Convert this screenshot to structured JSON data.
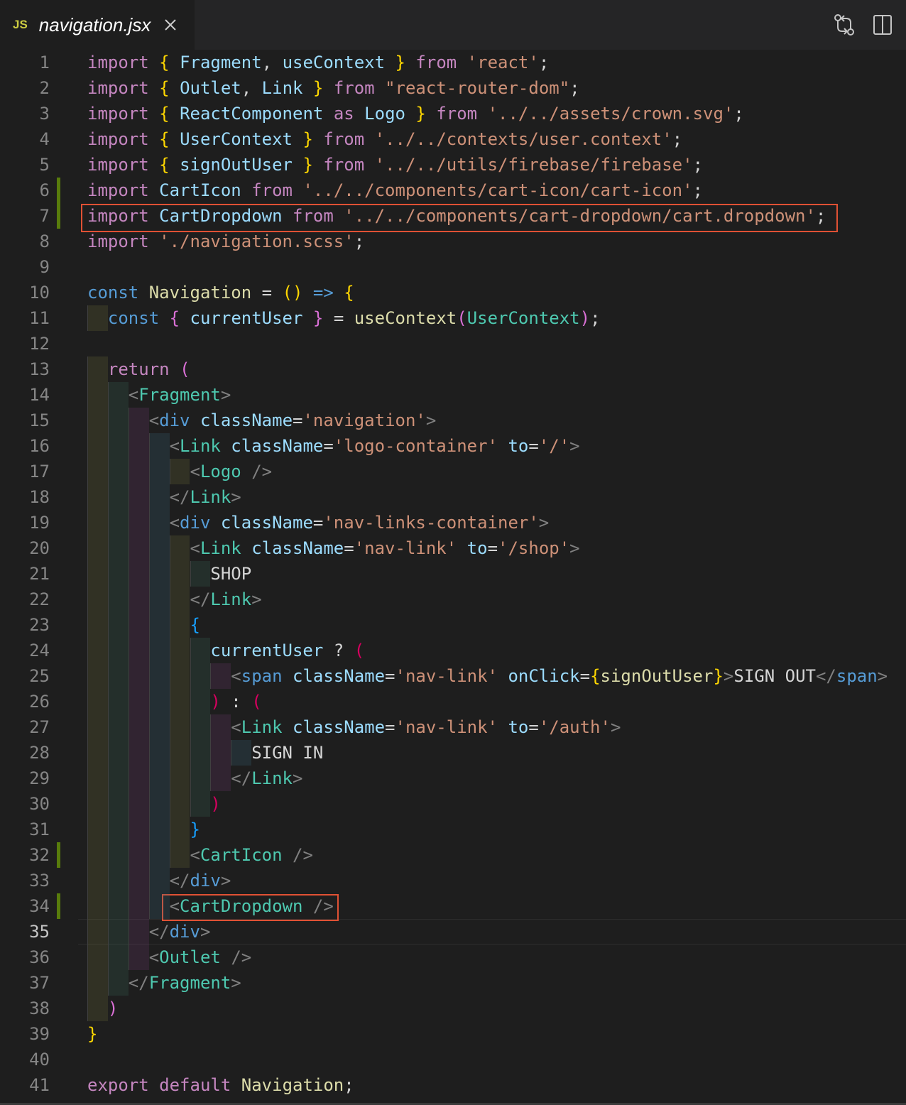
{
  "tab": {
    "language_badge": "JS",
    "filename": "navigation.jsx",
    "close_icon": "close-icon",
    "actions": [
      "compare-changes-icon",
      "split-editor-icon"
    ]
  },
  "colors": {
    "keyword": "#c586c0",
    "storage": "#569cd6",
    "variable": "#9cdcfe",
    "string": "#ce9178",
    "function": "#dcdcaa",
    "component": "#4ec9b0",
    "highlight_box": "#e05134",
    "git_added": "#587c0c"
  },
  "editor": {
    "active_line": 35,
    "lines": [
      {
        "n": 1,
        "tokens": [
          [
            "kw",
            "import"
          ],
          [
            "tx",
            " "
          ],
          [
            "b1",
            "{"
          ],
          [
            "tx",
            " "
          ],
          [
            "vr",
            "Fragment"
          ],
          [
            "tx",
            ", "
          ],
          [
            "vr",
            "useContext"
          ],
          [
            "tx",
            " "
          ],
          [
            "b1",
            "}"
          ],
          [
            "tx",
            " "
          ],
          [
            "kw",
            "from"
          ],
          [
            "tx",
            " "
          ],
          [
            "str",
            "'react'"
          ],
          [
            "tx",
            ";"
          ]
        ]
      },
      {
        "n": 2,
        "tokens": [
          [
            "kw",
            "import"
          ],
          [
            "tx",
            " "
          ],
          [
            "b1",
            "{"
          ],
          [
            "tx",
            " "
          ],
          [
            "vr",
            "Outlet"
          ],
          [
            "tx",
            ", "
          ],
          [
            "vr",
            "Link"
          ],
          [
            "tx",
            " "
          ],
          [
            "b1",
            "}"
          ],
          [
            "tx",
            " "
          ],
          [
            "kw",
            "from"
          ],
          [
            "tx",
            " "
          ],
          [
            "str",
            "\"react-router-dom\""
          ],
          [
            "tx",
            ";"
          ]
        ]
      },
      {
        "n": 3,
        "tokens": [
          [
            "kw",
            "import"
          ],
          [
            "tx",
            " "
          ],
          [
            "b1",
            "{"
          ],
          [
            "tx",
            " "
          ],
          [
            "vr",
            "ReactComponent"
          ],
          [
            "tx",
            " "
          ],
          [
            "kw",
            "as"
          ],
          [
            "tx",
            " "
          ],
          [
            "vr",
            "Logo"
          ],
          [
            "tx",
            " "
          ],
          [
            "b1",
            "}"
          ],
          [
            "tx",
            " "
          ],
          [
            "kw",
            "from"
          ],
          [
            "tx",
            " "
          ],
          [
            "str",
            "'../../assets/crown.svg'"
          ],
          [
            "tx",
            ";"
          ]
        ]
      },
      {
        "n": 4,
        "tokens": [
          [
            "kw",
            "import"
          ],
          [
            "tx",
            " "
          ],
          [
            "b1",
            "{"
          ],
          [
            "tx",
            " "
          ],
          [
            "vr",
            "UserContext"
          ],
          [
            "tx",
            " "
          ],
          [
            "b1",
            "}"
          ],
          [
            "tx",
            " "
          ],
          [
            "kw",
            "from"
          ],
          [
            "tx",
            " "
          ],
          [
            "str",
            "'../../contexts/user.context'"
          ],
          [
            "tx",
            ";"
          ]
        ]
      },
      {
        "n": 5,
        "tokens": [
          [
            "kw",
            "import"
          ],
          [
            "tx",
            " "
          ],
          [
            "b1",
            "{"
          ],
          [
            "tx",
            " "
          ],
          [
            "vr",
            "signOutUser"
          ],
          [
            "tx",
            " "
          ],
          [
            "b1",
            "}"
          ],
          [
            "tx",
            " "
          ],
          [
            "kw",
            "from"
          ],
          [
            "tx",
            " "
          ],
          [
            "str",
            "'../../utils/firebase/firebase'"
          ],
          [
            "tx",
            ";"
          ]
        ]
      },
      {
        "n": 6,
        "tokens": [
          [
            "kw",
            "import"
          ],
          [
            "tx",
            " "
          ],
          [
            "vr",
            "CartIcon"
          ],
          [
            "tx",
            " "
          ],
          [
            "kw",
            "from"
          ],
          [
            "tx",
            " "
          ],
          [
            "str",
            "'../../components/cart-icon/cart-icon'"
          ],
          [
            "tx",
            ";"
          ]
        ]
      },
      {
        "n": 7,
        "tokens": [
          [
            "kw",
            "import"
          ],
          [
            "tx",
            " "
          ],
          [
            "vr",
            "CartDropdown"
          ],
          [
            "tx",
            " "
          ],
          [
            "kw",
            "from"
          ],
          [
            "tx",
            " "
          ],
          [
            "str",
            "'../../components/cart-dropdown/cart.dropdown'"
          ],
          [
            "tx",
            ";"
          ]
        ]
      },
      {
        "n": 8,
        "tokens": [
          [
            "kw",
            "import"
          ],
          [
            "tx",
            " "
          ],
          [
            "str",
            "'./navigation.scss'"
          ],
          [
            "tx",
            ";"
          ]
        ]
      },
      {
        "n": 9,
        "tokens": []
      },
      {
        "n": 10,
        "tokens": [
          [
            "st",
            "const"
          ],
          [
            "tx",
            " "
          ],
          [
            "fn",
            "Navigation"
          ],
          [
            "tx",
            " = "
          ],
          [
            "b1",
            "()"
          ],
          [
            "tx",
            " "
          ],
          [
            "st",
            "=>"
          ],
          [
            "tx",
            " "
          ],
          [
            "b1",
            "{"
          ]
        ]
      },
      {
        "n": 11,
        "tokens": [
          [
            "tx",
            "  "
          ],
          [
            "st",
            "const"
          ],
          [
            "tx",
            " "
          ],
          [
            "b2",
            "{"
          ],
          [
            "tx",
            " "
          ],
          [
            "vr",
            "currentUser"
          ],
          [
            "tx",
            " "
          ],
          [
            "b2",
            "}"
          ],
          [
            "tx",
            " = "
          ],
          [
            "fn",
            "useContext"
          ],
          [
            "b2",
            "("
          ],
          [
            "cls",
            "UserContext"
          ],
          [
            "b2",
            ")"
          ],
          [
            "tx",
            ";"
          ]
        ]
      },
      {
        "n": 12,
        "tokens": []
      },
      {
        "n": 13,
        "tokens": [
          [
            "tx",
            "  "
          ],
          [
            "kw",
            "return"
          ],
          [
            "tx",
            " "
          ],
          [
            "b2",
            "("
          ]
        ]
      },
      {
        "n": 14,
        "tokens": [
          [
            "tx",
            "    "
          ],
          [
            "pu",
            "<"
          ],
          [
            "cls",
            "Fragment"
          ],
          [
            "pu",
            ">"
          ]
        ]
      },
      {
        "n": 15,
        "tokens": [
          [
            "tx",
            "      "
          ],
          [
            "pu",
            "<"
          ],
          [
            "tag",
            "div"
          ],
          [
            "tx",
            " "
          ],
          [
            "vr",
            "className"
          ],
          [
            "tx",
            "="
          ],
          [
            "str",
            "'navigation'"
          ],
          [
            "pu",
            ">"
          ]
        ]
      },
      {
        "n": 16,
        "tokens": [
          [
            "tx",
            "        "
          ],
          [
            "pu",
            "<"
          ],
          [
            "cls",
            "Link"
          ],
          [
            "tx",
            " "
          ],
          [
            "vr",
            "className"
          ],
          [
            "tx",
            "="
          ],
          [
            "str",
            "'logo-container'"
          ],
          [
            "tx",
            " "
          ],
          [
            "vr",
            "to"
          ],
          [
            "tx",
            "="
          ],
          [
            "str",
            "'/'"
          ],
          [
            "pu",
            ">"
          ]
        ]
      },
      {
        "n": 17,
        "tokens": [
          [
            "tx",
            "          "
          ],
          [
            "pu",
            "<"
          ],
          [
            "cls",
            "Logo"
          ],
          [
            "tx",
            " "
          ],
          [
            "pu",
            "/>"
          ]
        ]
      },
      {
        "n": 18,
        "tokens": [
          [
            "tx",
            "        "
          ],
          [
            "pu",
            "</"
          ],
          [
            "cls",
            "Link"
          ],
          [
            "pu",
            ">"
          ]
        ]
      },
      {
        "n": 19,
        "tokens": [
          [
            "tx",
            "        "
          ],
          [
            "pu",
            "<"
          ],
          [
            "tag",
            "div"
          ],
          [
            "tx",
            " "
          ],
          [
            "vr",
            "className"
          ],
          [
            "tx",
            "="
          ],
          [
            "str",
            "'nav-links-container'"
          ],
          [
            "pu",
            ">"
          ]
        ]
      },
      {
        "n": 20,
        "tokens": [
          [
            "tx",
            "          "
          ],
          [
            "pu",
            "<"
          ],
          [
            "cls",
            "Link"
          ],
          [
            "tx",
            " "
          ],
          [
            "vr",
            "className"
          ],
          [
            "tx",
            "="
          ],
          [
            "str",
            "'nav-link'"
          ],
          [
            "tx",
            " "
          ],
          [
            "vr",
            "to"
          ],
          [
            "tx",
            "="
          ],
          [
            "str",
            "'/shop'"
          ],
          [
            "pu",
            ">"
          ]
        ]
      },
      {
        "n": 21,
        "tokens": [
          [
            "tx",
            "            SHOP"
          ]
        ]
      },
      {
        "n": 22,
        "tokens": [
          [
            "tx",
            "          "
          ],
          [
            "pu",
            "</"
          ],
          [
            "cls",
            "Link"
          ],
          [
            "pu",
            ">"
          ]
        ]
      },
      {
        "n": 23,
        "tokens": [
          [
            "tx",
            "          "
          ],
          [
            "b3",
            "{"
          ]
        ]
      },
      {
        "n": 24,
        "tokens": [
          [
            "tx",
            "            "
          ],
          [
            "vr",
            "currentUser"
          ],
          [
            "tx",
            " ? "
          ],
          [
            "b4",
            "("
          ]
        ]
      },
      {
        "n": 25,
        "tokens": [
          [
            "tx",
            "              "
          ],
          [
            "pu",
            "<"
          ],
          [
            "tag",
            "span"
          ],
          [
            "tx",
            " "
          ],
          [
            "vr",
            "className"
          ],
          [
            "tx",
            "="
          ],
          [
            "str",
            "'nav-link'"
          ],
          [
            "tx",
            " "
          ],
          [
            "vr",
            "onClick"
          ],
          [
            "tx",
            "="
          ],
          [
            "b1",
            "{"
          ],
          [
            "fn",
            "signOutUser"
          ],
          [
            "b1",
            "}"
          ],
          [
            "pu",
            ">"
          ],
          [
            "tx",
            "SIGN OUT"
          ],
          [
            "pu",
            "</"
          ],
          [
            "tag",
            "span"
          ],
          [
            "pu",
            ">"
          ]
        ]
      },
      {
        "n": 26,
        "tokens": [
          [
            "tx",
            "            "
          ],
          [
            "b4",
            ")"
          ],
          [
            "tx",
            " : "
          ],
          [
            "b4",
            "("
          ]
        ]
      },
      {
        "n": 27,
        "tokens": [
          [
            "tx",
            "              "
          ],
          [
            "pu",
            "<"
          ],
          [
            "cls",
            "Link"
          ],
          [
            "tx",
            " "
          ],
          [
            "vr",
            "className"
          ],
          [
            "tx",
            "="
          ],
          [
            "str",
            "'nav-link'"
          ],
          [
            "tx",
            " "
          ],
          [
            "vr",
            "to"
          ],
          [
            "tx",
            "="
          ],
          [
            "str",
            "'/auth'"
          ],
          [
            "pu",
            ">"
          ]
        ]
      },
      {
        "n": 28,
        "tokens": [
          [
            "tx",
            "                SIGN IN"
          ]
        ]
      },
      {
        "n": 29,
        "tokens": [
          [
            "tx",
            "              "
          ],
          [
            "pu",
            "</"
          ],
          [
            "cls",
            "Link"
          ],
          [
            "pu",
            ">"
          ]
        ]
      },
      {
        "n": 30,
        "tokens": [
          [
            "tx",
            "            "
          ],
          [
            "b4",
            ")"
          ]
        ]
      },
      {
        "n": 31,
        "tokens": [
          [
            "tx",
            "          "
          ],
          [
            "b3",
            "}"
          ]
        ]
      },
      {
        "n": 32,
        "tokens": [
          [
            "tx",
            "          "
          ],
          [
            "pu",
            "<"
          ],
          [
            "cls",
            "CartIcon"
          ],
          [
            "tx",
            " "
          ],
          [
            "pu",
            "/>"
          ]
        ]
      },
      {
        "n": 33,
        "tokens": [
          [
            "tx",
            "        "
          ],
          [
            "pu",
            "</"
          ],
          [
            "tag",
            "div"
          ],
          [
            "pu",
            ">"
          ]
        ]
      },
      {
        "n": 34,
        "tokens": [
          [
            "tx",
            "        "
          ],
          [
            "pu",
            "<"
          ],
          [
            "cls",
            "CartDropdown"
          ],
          [
            "tx",
            " "
          ],
          [
            "pu",
            "/>"
          ]
        ]
      },
      {
        "n": 35,
        "tokens": [
          [
            "tx",
            "      "
          ],
          [
            "pu",
            "</"
          ],
          [
            "tag",
            "div"
          ],
          [
            "pu",
            ">"
          ]
        ]
      },
      {
        "n": 36,
        "tokens": [
          [
            "tx",
            "      "
          ],
          [
            "pu",
            "<"
          ],
          [
            "cls",
            "Outlet"
          ],
          [
            "tx",
            " "
          ],
          [
            "pu",
            "/>"
          ]
        ]
      },
      {
        "n": 37,
        "tokens": [
          [
            "tx",
            "    "
          ],
          [
            "pu",
            "</"
          ],
          [
            "cls",
            "Fragment"
          ],
          [
            "pu",
            ">"
          ]
        ]
      },
      {
        "n": 38,
        "tokens": [
          [
            "tx",
            "  "
          ],
          [
            "b2",
            ")"
          ]
        ]
      },
      {
        "n": 39,
        "tokens": [
          [
            "b1",
            "}"
          ]
        ]
      },
      {
        "n": 40,
        "tokens": []
      },
      {
        "n": 41,
        "tokens": [
          [
            "kw",
            "export"
          ],
          [
            "tx",
            " "
          ],
          [
            "kw",
            "default"
          ],
          [
            "tx",
            " "
          ],
          [
            "fn",
            "Navigation"
          ],
          [
            "tx",
            ";"
          ]
        ]
      }
    ]
  }
}
